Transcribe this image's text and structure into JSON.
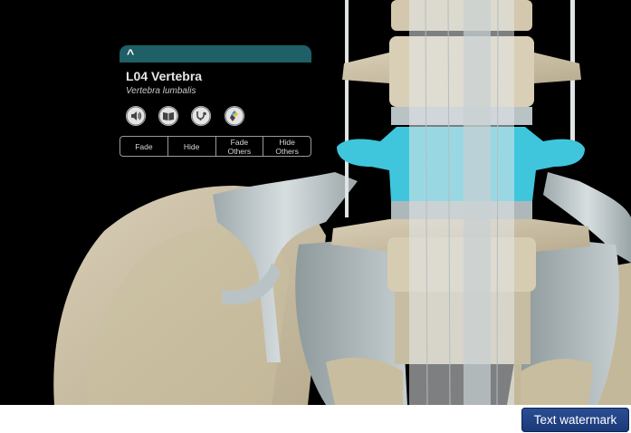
{
  "panel": {
    "collapse_glyph": "^",
    "title": "L04 Vertebra",
    "latin_name": "Vertebra lumbalis",
    "icons": [
      "speaker-icon",
      "book-icon",
      "stethoscope-icon",
      "color-palette-icon"
    ],
    "actions": [
      {
        "label": "Fade"
      },
      {
        "label": "Hide"
      },
      {
        "label": "Fade\nOthers"
      },
      {
        "label": "Hide\nOthers"
      }
    ],
    "header_color": "#1f5f66",
    "highlight_color": "#3fc6dc"
  },
  "watermark": {
    "label": "Text watermark",
    "color": "#1f3f86"
  }
}
